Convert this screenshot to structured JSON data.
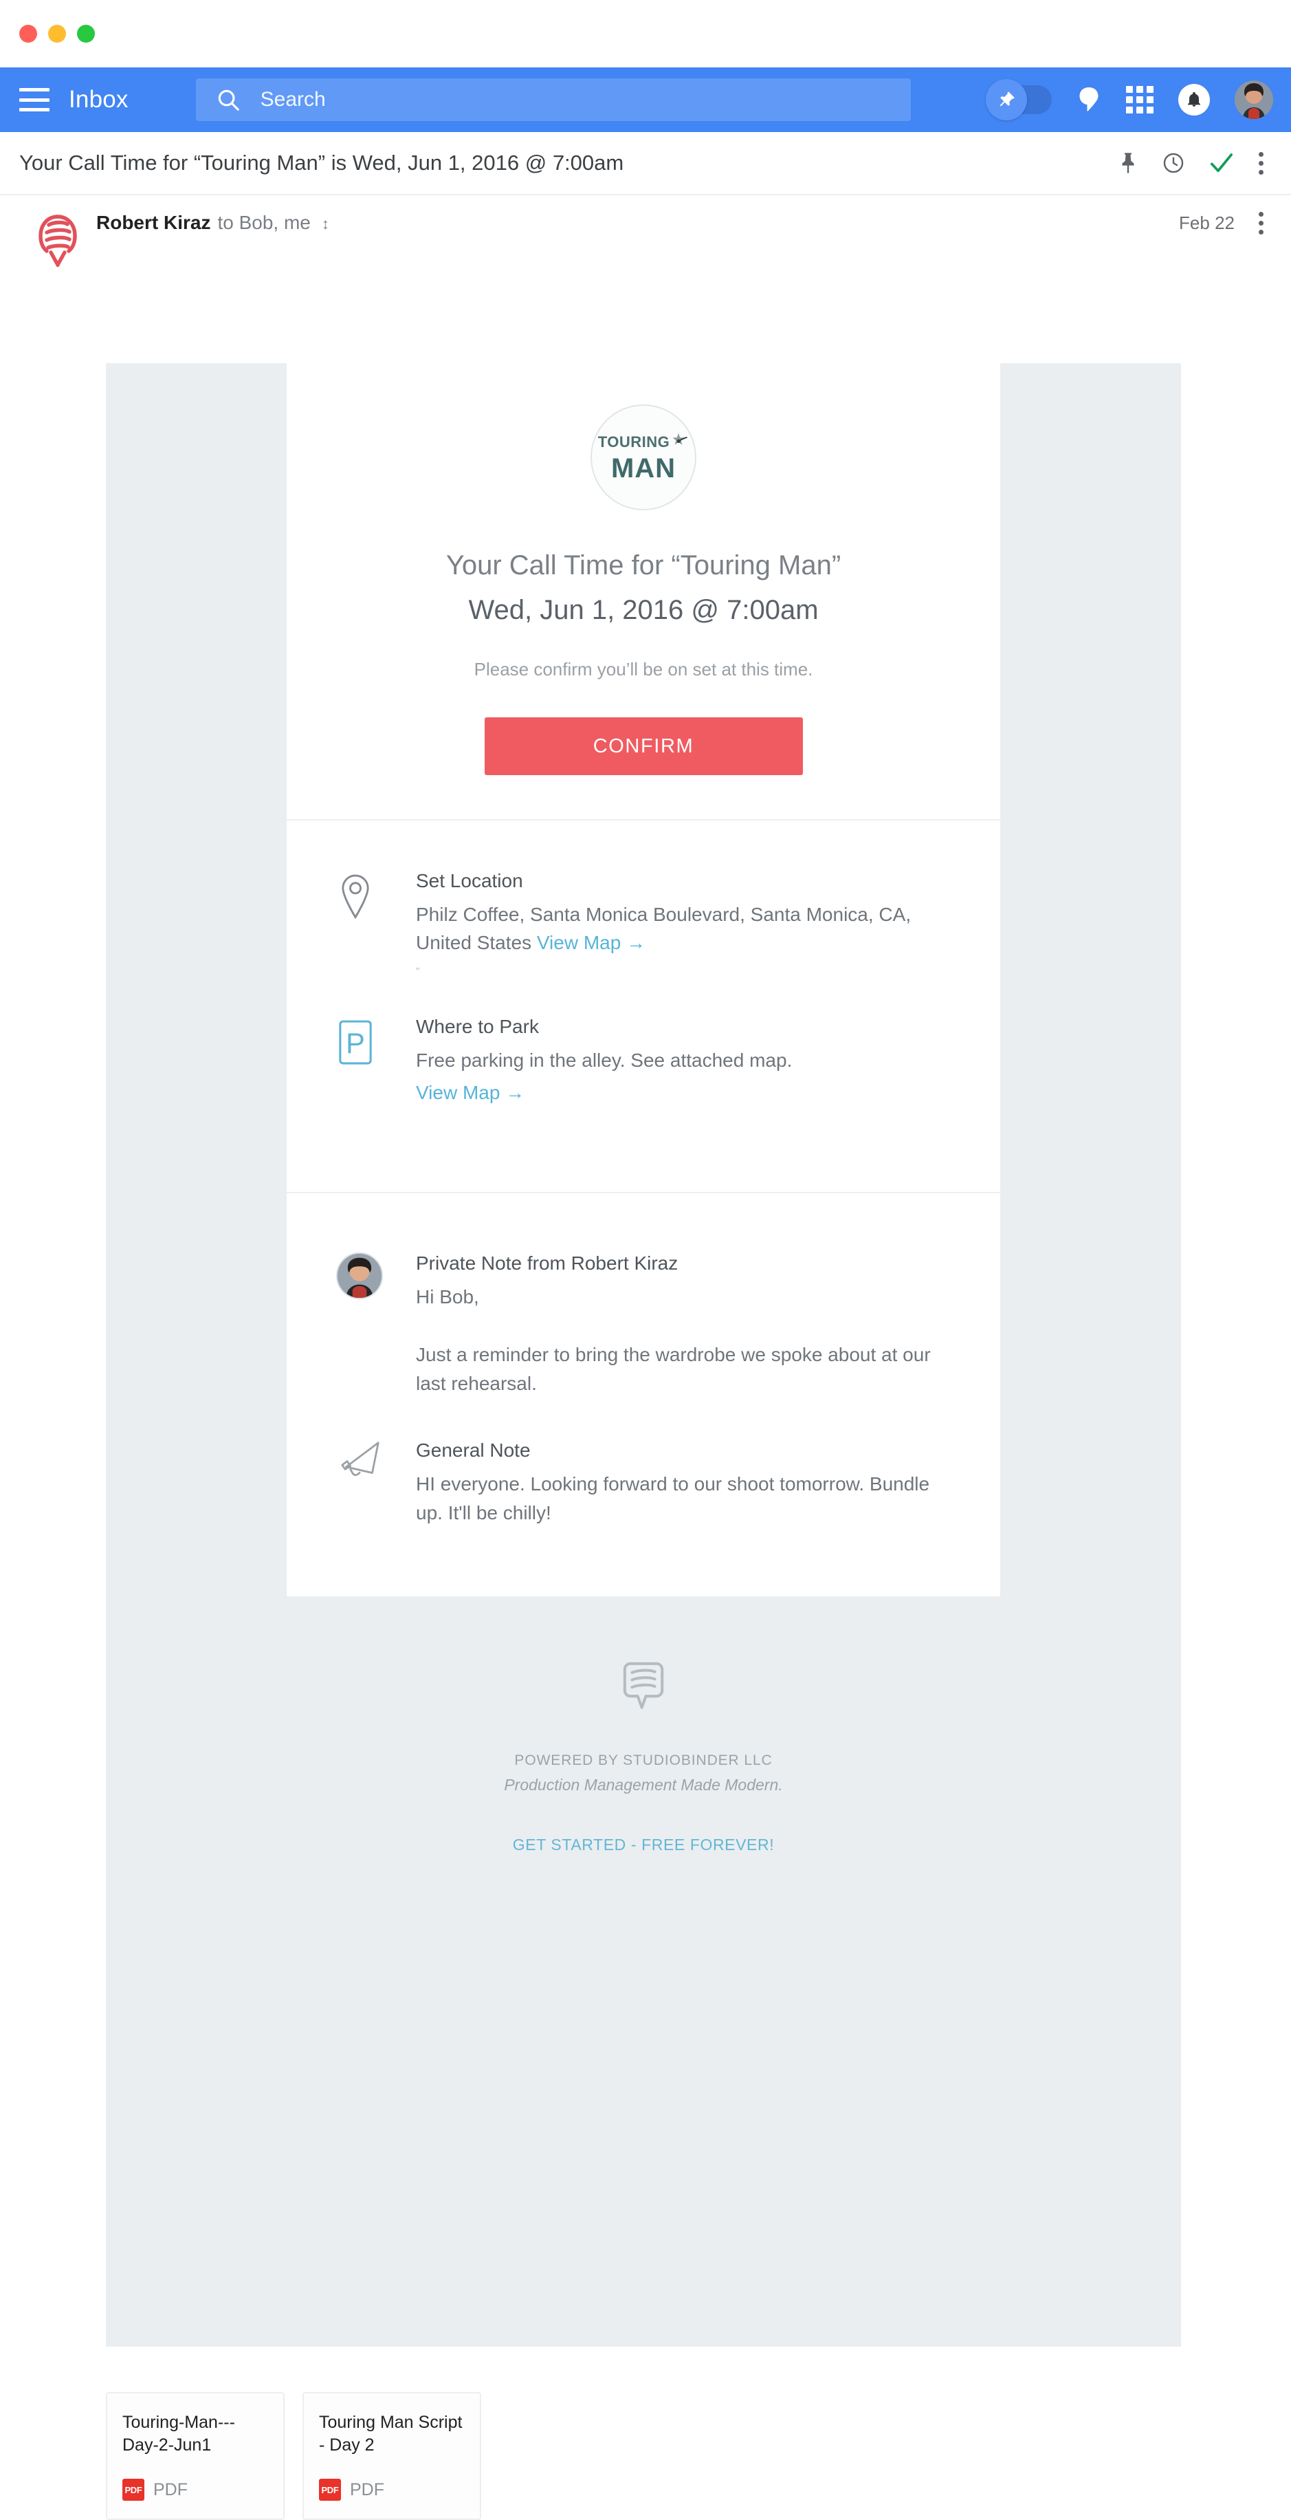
{
  "window": {
    "traffic_lights": [
      "close",
      "minimize",
      "zoom"
    ]
  },
  "appbar": {
    "menu_icon": "hamburger-menu-icon",
    "title": "Inbox",
    "search": {
      "icon": "search-icon",
      "placeholder": "Search",
      "value": ""
    },
    "pin_toggle": {
      "icon": "pin-icon",
      "state": "on"
    },
    "icons": [
      {
        "name": "hangouts-icon",
        "label": "Hangouts"
      },
      {
        "name": "apps-grid-icon",
        "label": "Google apps"
      },
      {
        "name": "notifications-bell-icon",
        "label": "Notifications"
      }
    ],
    "avatar": {
      "name": "user-avatar",
      "label": "Account"
    }
  },
  "subject_bar": {
    "subject": "Your Call Time for “Touring Man” is Wed, Jun 1, 2016 @ 7:00am",
    "actions": [
      {
        "name": "pin-icon",
        "label": "Pin"
      },
      {
        "name": "snooze-clock-icon",
        "label": "Snooze"
      },
      {
        "name": "done-check-icon",
        "label": "Mark done"
      },
      {
        "name": "more-options-kebab-icon",
        "label": "More"
      }
    ]
  },
  "message": {
    "brand_icon": "studiobinder-speech-bubble-icon",
    "sender": "Robert Kiraz",
    "recipients": "to Bob, me",
    "expand_icon": "expand-details-caret-icon",
    "date": "Feb 22",
    "more_icon": "more-options-kebab-icon"
  },
  "email": {
    "logo": {
      "icon": "touring-man-logo",
      "line1": "TOURING",
      "line2": "MAN",
      "star_icon": "guitar-star-icon"
    },
    "title": "Your Call Time for “Touring Man”",
    "date": "Wed, Jun 1, 2016 @ 7:00am",
    "subtitle": "Please confirm you’ll be on set at this time.",
    "confirm_label": "CONFIRM",
    "info_rows": [
      {
        "icon": "map-pin-icon",
        "title": "Set Location",
        "text": "Philz Coffee, Santa Monica Boulevard, Santa Monica, CA, United States ",
        "link": "View Map →",
        "link_inline": true,
        "trailing_dot": "”"
      },
      {
        "icon": "parking-p-icon",
        "title": "Where to Park",
        "text": "Free parking in the alley. See attached map.",
        "link": "View Map →",
        "link_inline": false
      }
    ],
    "notes": [
      {
        "icon": "note-author-avatar",
        "title": "Private Note from Robert Kiraz",
        "text": "Hi Bob,",
        "text2": "Just a reminder to bring the wardrobe we spoke about at our last rehearsal."
      },
      {
        "icon": "megaphone-icon",
        "title": "General Note",
        "text": "HI everyone. Looking forward to our shoot tomorrow. Bundle up. It'll be chilly!",
        "text2": ""
      }
    ],
    "footer": {
      "icon": "studiobinder-speech-bubble-outline-icon",
      "powered_by": "POWERED BY STUDIOBINDER LLC",
      "tagline": "Production Management Made Modern.",
      "cta": "GET STARTED - FREE FOREVER!"
    }
  },
  "attachments": [
    {
      "name": "Touring-Man---Day-2-Jun1",
      "type": "PDF",
      "badge": "PDF"
    },
    {
      "name": "Touring Man Script - Day 2",
      "type": "PDF",
      "badge": "PDF"
    }
  ],
  "colors": {
    "appbar_blue": "#4285f4",
    "confirm_red": "#ef5b60",
    "link_blue": "#56b4d8",
    "canvas_gray": "#eaeef0",
    "brand_red": "#e2515a",
    "brand_teal": "#3f6a6a"
  }
}
